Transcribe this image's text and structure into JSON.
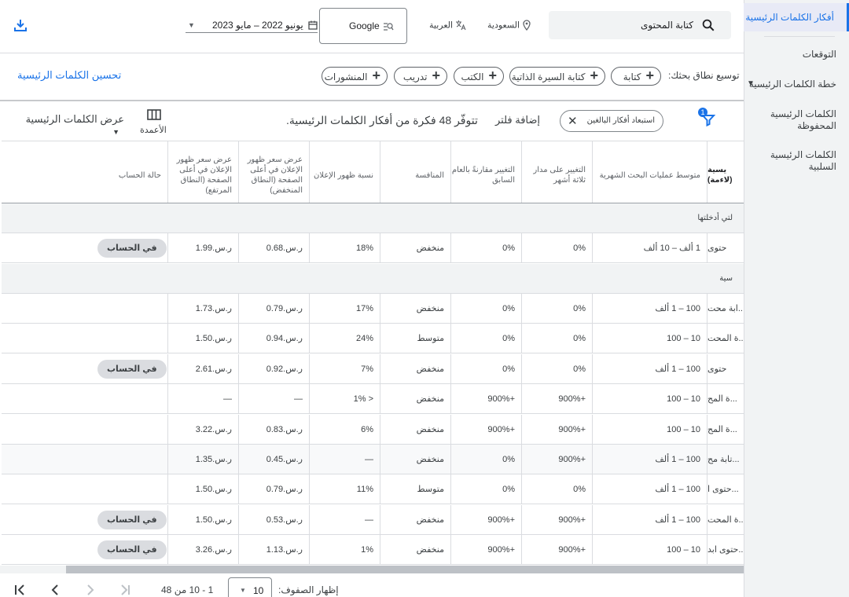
{
  "nav": {
    "items": [
      {
        "label": "أفكار الكلمات الرئيسية"
      },
      {
        "label": "التوقعات"
      },
      {
        "label": "خطة الكلمات الرئيسية"
      },
      {
        "label": "الكلمات الرئيسية المحفوظة"
      },
      {
        "label": "الكلمات الرئيسية السلبية"
      }
    ]
  },
  "topbar": {
    "search_value": "كتابة المحتوى",
    "location": "السعودية",
    "language": "العربية",
    "network": "Google",
    "date_range": "يونيو 2022 – مايو 2023"
  },
  "broaden": {
    "label": "توسيع نطاق بحثك:",
    "pills": [
      "كتابة",
      "كتابة السيرة الذاتية",
      "الكتب",
      "تدريب",
      "المنشورات"
    ],
    "refine_link": "تحسين الكلمات الرئيسية"
  },
  "filterbar": {
    "filter_count": "1",
    "exclude_chip": "استبعاد أفكار البالغين",
    "add_filter": "إضافة فلتر",
    "summary": "تتوفّر 48 فكرة من أفكار الكلمات الرئيسية.",
    "columns_label": "الأعمدة",
    "view_label": "عرض الكلمات الرئيسية"
  },
  "table": {
    "headers": {
      "keyword": "يسية (لاءمة)",
      "avg_searches": "متوسط عمليات البحث الشهرية",
      "three_month": "التغيير على مدار ثلاثة أشهر",
      "yoy": "التغيير مقارنةً بالعام السابق",
      "competition": "المنافسة",
      "impression_share": "نسبة ظهور الإعلان",
      "bid_low": "عرض سعر ظهور الإعلان في أعلى الصفحة (النطاق المنخفض)",
      "bid_high": "عرض سعر ظهور الإعلان في أعلى الصفحة (النطاق المرتفع)",
      "status": "حالة الحساب"
    },
    "section1": "لتي أدخلتها",
    "section2": "سية",
    "rows1": [
      {
        "kw": "حتوى",
        "avg": "1 ألف – 10 ألف",
        "m3": "0%",
        "yoy": "0%",
        "comp": "منخفض",
        "share": "18%",
        "low": "ر.س.0.68",
        "high": "ر.س.1.99",
        "status": "في الحساب"
      }
    ],
    "rows2": [
      {
        "kw": "ابة محت...",
        "avg": "100 – 1 ألف",
        "m3": "0%",
        "yoy": "0%",
        "comp": "منخفض",
        "share": "17%",
        "low": "ر.س.0.79",
        "high": "ر.س.1.73",
        "status": ""
      },
      {
        "kw": "ة المحت...",
        "avg": "10 – 100",
        "m3": "0%",
        "yoy": "0%",
        "comp": "متوسط",
        "share": "24%",
        "low": "ر.س.0.94",
        "high": "ر.س.1.50",
        "status": ""
      },
      {
        "kw": "حتوى",
        "avg": "100 – 1 ألف",
        "m3": "0%",
        "yoy": "0%",
        "comp": "منخفض",
        "share": "7%",
        "low": "ر.س.0.92",
        "high": "ر.س.2.61",
        "status": "في الحساب"
      },
      {
        "kw": "ة المح...",
        "avg": "10 – 100",
        "m3": "+900%",
        "yoy": "+900%",
        "comp": "منخفض",
        "share": "< 1%",
        "low": "—",
        "high": "—",
        "status": ""
      },
      {
        "kw": "ة المح...",
        "avg": "10 – 100",
        "m3": "+900%",
        "yoy": "+900%",
        "comp": "منخفض",
        "share": "6%",
        "low": "ر.س.0.83",
        "high": "ر.س.3.22",
        "status": ""
      },
      {
        "kw": "تابة مح...",
        "avg": "100 – 1 ألف",
        "m3": "+900%",
        "yoy": "0%",
        "comp": "منخفض",
        "share": "—",
        "low": "ر.س.0.45",
        "high": "ر.س.1.35",
        "status": ""
      },
      {
        "kw": "حتوى ا...",
        "avg": "100 – 1 ألف",
        "m3": "0%",
        "yoy": "0%",
        "comp": "متوسط",
        "share": "11%",
        "low": "ر.س.0.79",
        "high": "ر.س.1.50",
        "status": ""
      },
      {
        "kw": "ة المحت...",
        "avg": "100 – 1 ألف",
        "m3": "+900%",
        "yoy": "+900%",
        "comp": "منخفض",
        "share": "—",
        "low": "ر.س.0.53",
        "high": "ر.س.1.50",
        "status": "في الحساب"
      },
      {
        "kw": "حتوى ابد...",
        "avg": "10 – 100",
        "m3": "+900%",
        "yoy": "+900%",
        "comp": "منخفض",
        "share": "1%",
        "low": "ر.س.1.13",
        "high": "ر.س.3.26",
        "status": "في الحساب"
      }
    ]
  },
  "footer": {
    "rows_label": "إظهار الصفوف:",
    "rows_value": "10",
    "range": "1 - 10 من 48"
  }
}
